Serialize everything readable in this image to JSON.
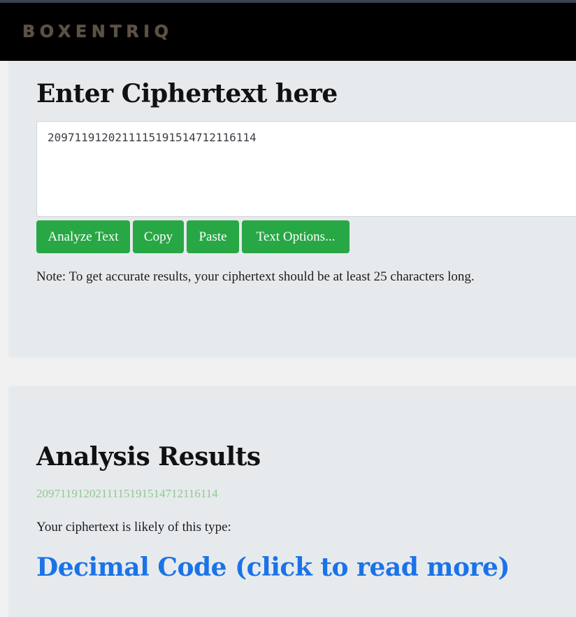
{
  "navbar": {
    "brand": "BOXENTRIQ"
  },
  "input_panel": {
    "title": "Enter Ciphertext here",
    "ciphertext": "2097119120211115191514712116114",
    "buttons": {
      "analyze": "Analyze Text",
      "copy": "Copy",
      "paste": "Paste",
      "options": "Text Options..."
    },
    "note": "Note: To get accurate results, your ciphertext should be at least 25 characters long."
  },
  "results_panel": {
    "title": "Analysis Results",
    "echo": "2097119120211115191514712116114",
    "likely_label": "Your ciphertext is likely of this type:",
    "result_link": "Decimal Code (click to read more)"
  },
  "colors": {
    "navbar_bg": "#000000",
    "panel_bg": "#e7eaed",
    "button_green": "#28a745",
    "link_blue": "#1a73e8",
    "echo_green": "#8fc98f"
  }
}
